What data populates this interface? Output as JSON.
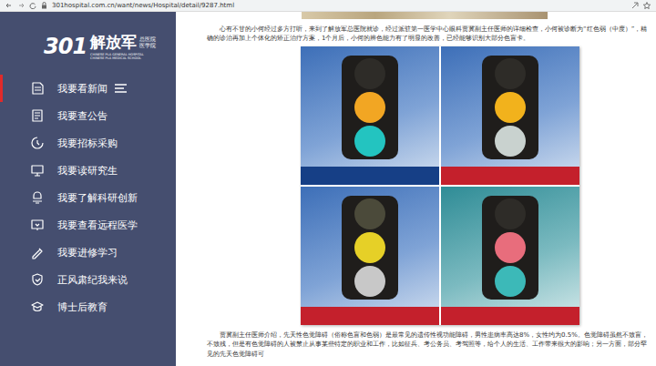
{
  "browser": {
    "url": "301hospital.com.cn/want/news/Hospital/detail/9287.html"
  },
  "logo": {
    "number": "301",
    "name": "解放军",
    "sub_top": "总医院",
    "sub_bottom": "医学院",
    "en_top": "CHINESE PLA GENERAL HOSPITAL",
    "en_bottom": "CHINESE PLA MEDICAL SCHOOL"
  },
  "sidebar": {
    "items": [
      {
        "label": "我要看新闻",
        "selected": true
      },
      {
        "label": "我要查公告",
        "selected": false
      },
      {
        "label": "我要招标采购",
        "selected": false
      },
      {
        "label": "我要读研究生",
        "selected": false
      },
      {
        "label": "我要了解科研创新",
        "selected": false
      },
      {
        "label": "我要查看远程医学",
        "selected": false
      },
      {
        "label": "我要进修学习",
        "selected": false
      },
      {
        "label": "正风肃纪我来说",
        "selected": false
      },
      {
        "label": "博士后教育",
        "selected": false
      }
    ]
  },
  "article": {
    "paragraph_top": "心有不甘的小何经过多方打听，来到了解放军总医院就诊，经过派驻第一医学中心眼科贾冀副主任医师的详细检查，小何被诊断为“红色弱（中度）”，精确的诊治再加上个体化的矫正治疗方案，1个月后，小何的辨色能力有了明显的改善，已经能够识别大部分色盲卡。",
    "paragraph_bottom": "贾冀副主任医师介绍，先天性色觉障碍（俗称色盲和色弱）是最常见的遗传性视功能障碍，男性患病率高达8%，女性约为0.5%。色觉障碍虽然不致盲，不致残，但是有色觉障碍的人被禁止从事某些特定的职业和工作，比如征兵、考公务员、考驾照等，给个人的生活、工作带来很大的影响；另一方面，部分罕见的先天色觉障碍可"
  }
}
